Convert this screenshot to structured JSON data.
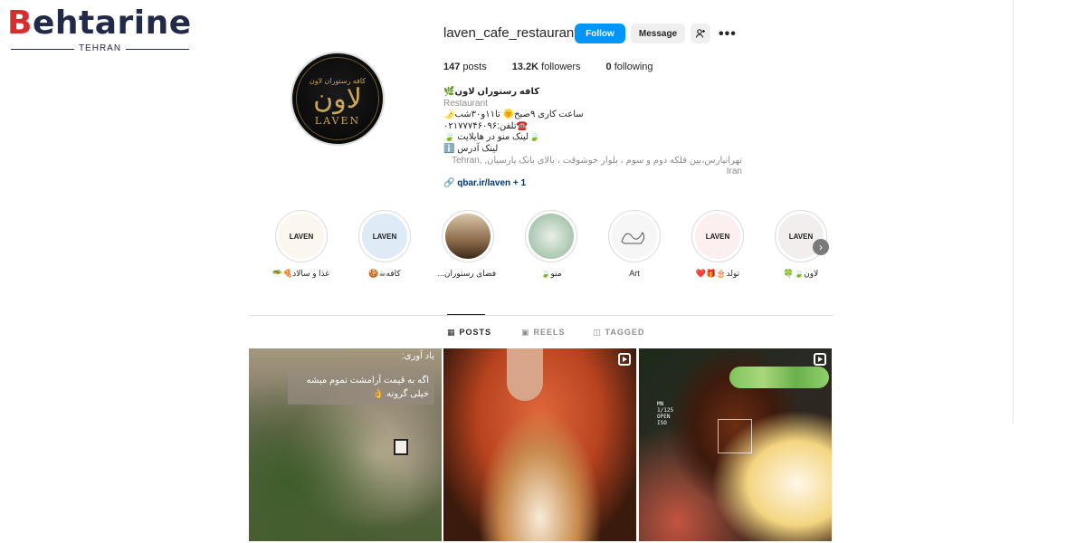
{
  "watermark": {
    "word_first": "B",
    "word_rest": "ehtarine",
    "sub": "TEHRAN"
  },
  "profile": {
    "username": "laven_cafe_restaurant",
    "follow_label": "Follow",
    "message_label": "Message",
    "avatar": {
      "top_text": "کافه رستوران لاون",
      "script_text": "لاون",
      "name_text": "LAVEN"
    },
    "stats": [
      {
        "value": "147",
        "label": "posts"
      },
      {
        "value": "13.2K",
        "label": "followers"
      },
      {
        "value": "0",
        "label": "following"
      }
    ],
    "bio": {
      "name": "کافه رستوران لاون🌿",
      "category": "Restaurant",
      "lines": [
        "ساعت کاری ۹صبح🌞 تا۱۱و۳۰شب🌛",
        "☎️تلفن:۰۲۱۷۷۷۴۶۰۹۶",
        "🍃لینک منو در هایلایت 🍃",
        "لینک آدرس ℹ️"
      ],
      "location": "تهرانپارس،بین فلکه دوم و سوم ، بلوار خوشوقت ، بالای بانک پارسیان, Tehran, Iran",
      "link": "qbar.ir/laven + 1"
    }
  },
  "highlights": [
    {
      "label": "غذا و سالاد🍕🥗",
      "cover": "LAVEN",
      "bg": "#fbf7ee"
    },
    {
      "label": "کافه☕🍪",
      "cover": "LAVEN",
      "bg": "#dfeaf7"
    },
    {
      "label": "فضای رستوران...",
      "cover": "",
      "bg": "#8b6a4a"
    },
    {
      "label": "منو🍃",
      "cover": "",
      "bg": "#8fb59a"
    },
    {
      "label": "Art",
      "cover": "",
      "bg": "#f6f6f6"
    },
    {
      "label": "تولد🎂🎁❤️",
      "cover": "LAVEN",
      "bg": "#fbeff0"
    },
    {
      "label": "لاون🍃🍀",
      "cover": "LAVEN",
      "bg": "#f3eeee"
    }
  ],
  "tabs": [
    {
      "label": "POSTS",
      "icon": "grid-icon"
    },
    {
      "label": "REELS",
      "icon": "reels-icon"
    },
    {
      "label": "TAGGED",
      "icon": "tagged-icon"
    }
  ],
  "posts": [
    {
      "title": "یاد آوری:",
      "overlay": "اگه به قیمت آرامشت تموم میشه خیلی گرونه 👌"
    },
    {
      "title": "",
      "overlay": ""
    },
    {
      "title": "",
      "overlay": "",
      "camera_text": [
        "MN",
        "1/125",
        "OPEN",
        "ISO"
      ]
    }
  ],
  "colors": {
    "accent": "#0095f6",
    "brand_red": "#d32f2f",
    "brand_navy": "#222a4a"
  }
}
